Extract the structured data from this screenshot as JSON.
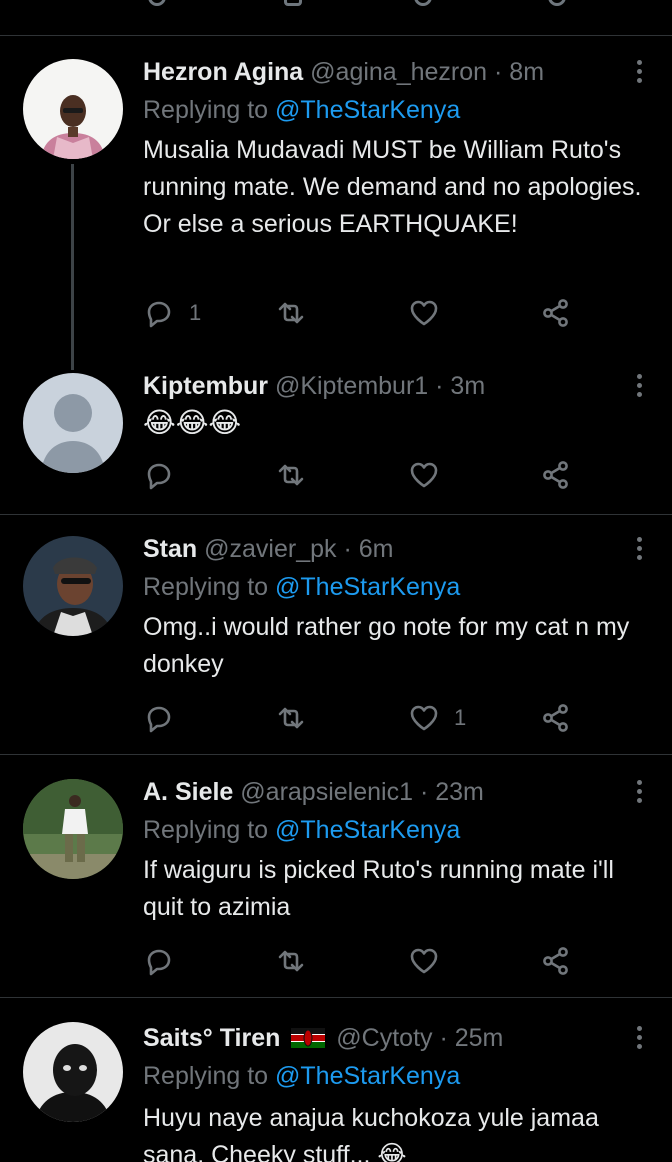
{
  "tweets": [
    {
      "name": "Hezron Agina",
      "handle": "@agina_hezron",
      "dot": "·",
      "time": "8m",
      "replying_prefix": "Replying to ",
      "replying_to": "@TheStarKenya",
      "text": "Musalia Mudavadi MUST be William Ruto's running mate. We demand and no apologies. Or else a serious EARTHQUAKE!",
      "reply_count": "1",
      "like_count": ""
    },
    {
      "name": "Kiptembur",
      "handle": "@Kiptembur1",
      "dot": "·",
      "time": "3m",
      "replying_prefix": "",
      "replying_to": "",
      "text": "😂😂😂",
      "reply_count": "",
      "like_count": ""
    },
    {
      "name": "Stan",
      "handle": "@zavier_pk",
      "dot": "·",
      "time": "6m",
      "replying_prefix": "Replying to ",
      "replying_to": "@TheStarKenya",
      "text": "Omg..i would rather go note for my cat n my donkey",
      "reply_count": "",
      "like_count": "1"
    },
    {
      "name": "A. Siele",
      "handle": "@arapsielenic1",
      "dot": "·",
      "time": "23m",
      "replying_prefix": "Replying to ",
      "replying_to": "@TheStarKenya",
      "text": "If waiguru is picked Ruto's running mate i'll quit to azimia",
      "reply_count": "",
      "like_count": ""
    },
    {
      "name": "Saits° Tiren",
      "handle": "@Cytoty",
      "dot": "·",
      "time": "25m",
      "flag": "Kenya flag",
      "replying_prefix": "Replying to ",
      "replying_to": "@TheStarKenya",
      "text": "Huyu naye anajua kuchokoza yule jamaa sana. Cheeky stuff... 😂",
      "reply_count": "",
      "like_count": ""
    }
  ],
  "icons": [
    "reply-icon",
    "retweet-icon",
    "like-icon",
    "share-icon",
    "more-icon"
  ],
  "colors": {
    "background": "#000000",
    "text": "#e7e9ea",
    "muted": "#71767b",
    "link": "#1d9bf0",
    "divider": "#2f3336"
  }
}
